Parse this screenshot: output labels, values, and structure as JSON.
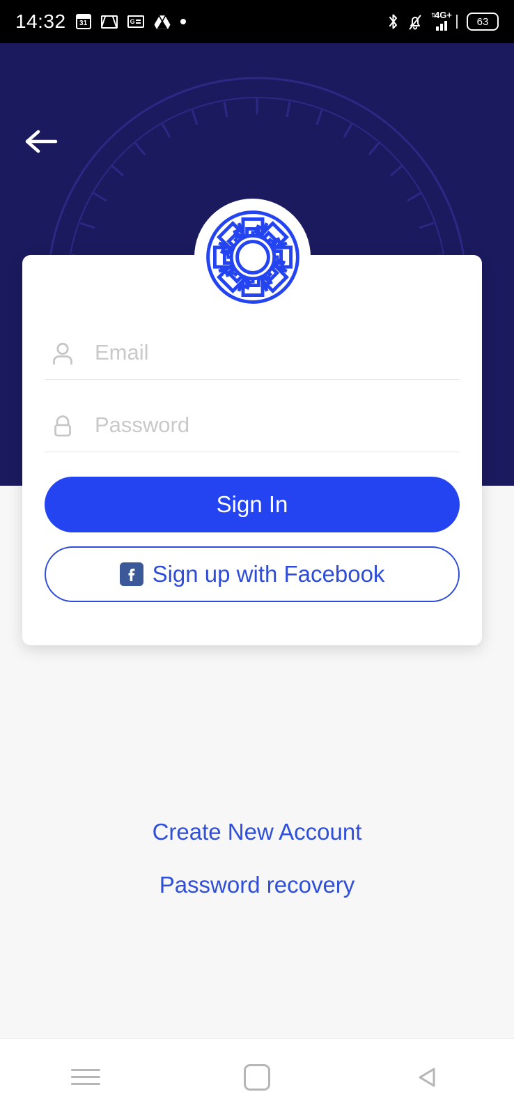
{
  "status_bar": {
    "clock": "14:32",
    "calendar_day": "31",
    "news_label": "G",
    "battery_level": "63",
    "network_type": "4G+",
    "icons": [
      "calendar-icon",
      "gmail-icon",
      "google-news-icon",
      "google-drive-icon",
      "dot-icon",
      "bluetooth-icon",
      "notifications-muted-icon",
      "signal-icon",
      "battery-icon"
    ]
  },
  "header": {
    "back_icon": "back-arrow-icon",
    "logo_icon": "greek-meander-wheel-logo",
    "background_color": "#1b1a5e"
  },
  "form": {
    "email": {
      "icon": "person-icon",
      "placeholder": "Email",
      "value": ""
    },
    "password": {
      "icon": "lock-icon",
      "placeholder": "Password",
      "value": ""
    },
    "sign_in_label": "Sign In",
    "facebook_label": "Sign up with Facebook",
    "facebook_icon": "facebook-icon"
  },
  "links": [
    {
      "label": "Create New Account",
      "name": "create-new-account-link"
    },
    {
      "label": "Password recovery",
      "name": "password-recovery-link"
    }
  ],
  "nav_bar": {
    "recents_icon": "recents-icon",
    "home_icon": "home-icon",
    "back_icon": "back-triangle-icon"
  },
  "colors": {
    "primary_blue": "#2344f0",
    "link_blue": "#2f4fd8",
    "header_navy": "#1b1a5e",
    "page_background": "#f7f7f7",
    "placeholder_gray": "#c9c9c9"
  }
}
